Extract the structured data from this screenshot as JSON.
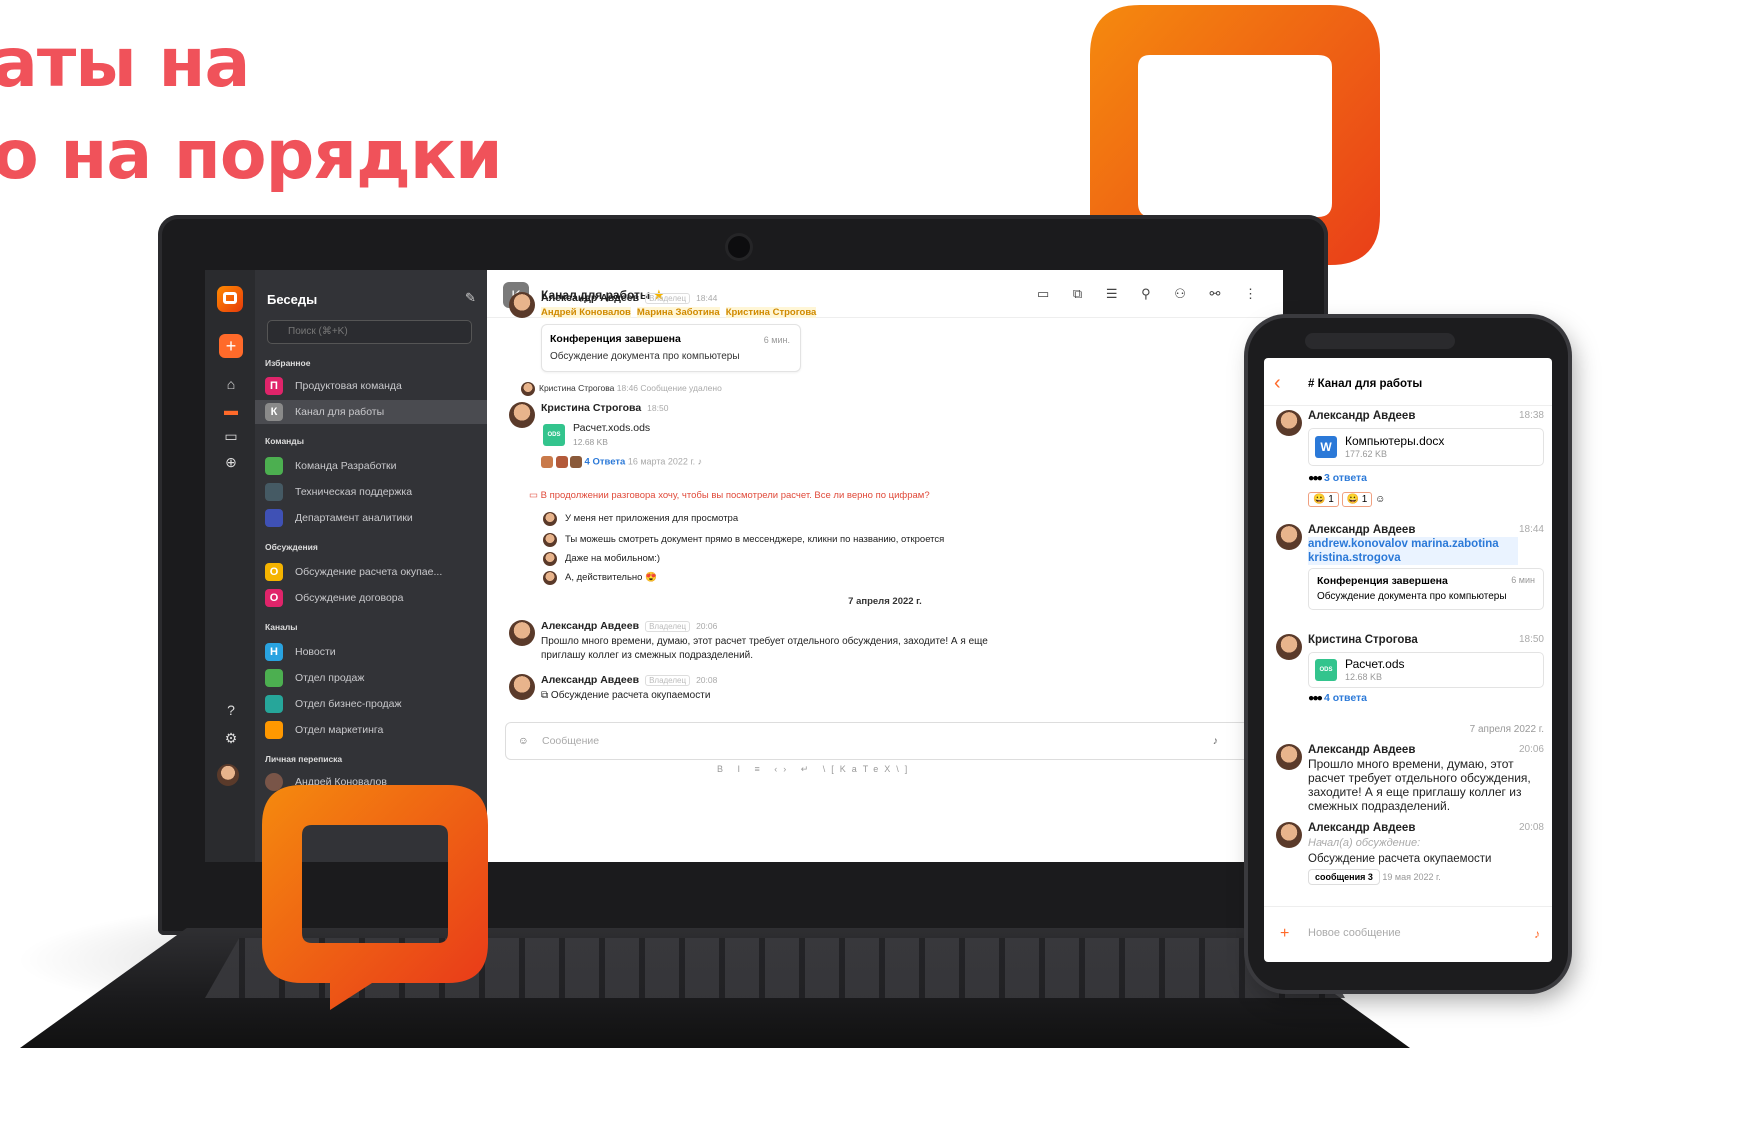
{
  "headline": {
    "line1": "аты на",
    "line2": "о на порядки"
  },
  "laptop": {
    "sidebar": {
      "title": "Беседы",
      "search_placeholder": "Поиск (⌘+K)",
      "sections": {
        "favorites": "Избранное",
        "teams": "Команды",
        "discussions": "Обсуждения",
        "channels": "Каналы",
        "personal": "Личная переписка"
      },
      "items": [
        {
          "label": "Продуктовая команда",
          "avatar": "П",
          "color": "#e0246a"
        },
        {
          "label": "Канал для работы",
          "avatar": "К",
          "color": "#8a8a8a"
        },
        {
          "label": "Команда Разработки",
          "avatar": "",
          "color": "#4caf50"
        },
        {
          "label": "Техническая поддержка",
          "avatar": "",
          "color": "#455a64"
        },
        {
          "label": "Департамент аналитики",
          "avatar": "",
          "color": "#3f51b5"
        },
        {
          "label": "Обсуждение расчета окупае...",
          "avatar": "О",
          "color": "#f5b400"
        },
        {
          "label": "Обсуждение договора",
          "avatar": "О",
          "color": "#e0246a"
        },
        {
          "label": "Новости",
          "avatar": "Н",
          "color": "#29a3e0"
        },
        {
          "label": "Отдел продаж",
          "avatar": "",
          "color": "#4caf50"
        },
        {
          "label": "Отдел бизнес-продаж",
          "avatar": "",
          "color": "#26a69a"
        },
        {
          "label": "Отдел маркетинга",
          "avatar": "",
          "color": "#ff9800"
        },
        {
          "label": "Андрей Коновалов",
          "avatar": "",
          "color": "#795548"
        }
      ]
    },
    "chat": {
      "header": {
        "avatar": "K",
        "title": "Канал для работы",
        "star": "★",
        "icons": "▭ ⧉ ☰ ⚲ ⚇ ⚯ ⋮"
      },
      "m1": {
        "name": "Александр Авдеев",
        "role": "Владелец",
        "time": "18:44",
        "mentions": [
          "Андрей Коновалов",
          "Марина Заботина",
          "Кристина Строгова"
        ],
        "card_title": "Конференция завершена",
        "card_time": "6 мин.",
        "card_text": "Обсуждение документа про компьютеры"
      },
      "deleted": {
        "name": "Кристина Строгова",
        "time": "18:46",
        "text": "Сообщение удалено"
      },
      "m2": {
        "name": "Кристина Строгова",
        "time": "18:50",
        "file": "Расчет.xods.ods",
        "size": "12.68 KB",
        "file_badge": "ODS",
        "replies": "4 Ответа",
        "date": "16 марта 2022 г."
      },
      "thread": {
        "question": "В продолжении разговора хочу, чтобы вы посмотрели расчет. Все ли верно по цифрам?",
        "lines": [
          "У меня нет приложения для просмотра",
          "Ты можешь смотреть документ прямо в мессенджере, кликни по названию, откроется",
          "Даже на мобильном:)",
          "А, действительно 😍"
        ]
      },
      "date_sep": "7 апреля 2022 г.",
      "m3": {
        "name": "Александр Авдеев",
        "role": "Владелец",
        "time": "20:06",
        "text1": "Прошло много времени, думаю, этот расчет требует отдельного обсуждения, заходите! А я еще",
        "text2": "приглашу коллег из смежных подразделений."
      },
      "m4": {
        "name": "Александр Авдеев",
        "role": "Владелец",
        "time": "20:08",
        "text": "Обсуждение расчета окупаемости"
      },
      "composer_placeholder": "Сообщение",
      "format_bar": "B I ≡ ‹› ↵ \\[KaTeX\\]"
    }
  },
  "phone": {
    "header": {
      "back": "‹",
      "title": "Канал для работы"
    },
    "m1": {
      "name": "Александр Авдеев",
      "time": "18:38",
      "file": "Компьютеры.docx",
      "size": "177.62 KB",
      "replies": "3 ответа",
      "react1": "😀 1",
      "react2": "😀 1"
    },
    "m2": {
      "name": "Александр Авдеев",
      "time": "18:44",
      "mentions": "andrew.konovalov marina.zabotina kristina.strogova",
      "card_title": "Конференция завершена",
      "card_time": "6 мин",
      "card_text": "Обсуждение документа про компьютеры"
    },
    "m3": {
      "name": "Кристина Строгова",
      "time": "18:50",
      "file": "Расчет.ods",
      "size": "12.68 KB",
      "replies": "4 ответа"
    },
    "date_sep": "7 апреля 2022 г.",
    "m4": {
      "name": "Александр Авдеев",
      "time": "20:06",
      "text": "Прошло много времени, думаю, этот расчет требует отдельного обсуждения, заходите! А я еще приглашу коллег из смежных подразделений."
    },
    "m5": {
      "name": "Александр Авдеев",
      "time": "20:08",
      "sub": "Начал(а) обсуждение:",
      "text": "Обсуждение расчета окупаемости",
      "thread": "сообщения 3",
      "date": "19 мая 2022 г."
    },
    "composer_placeholder": "Новое сообщение"
  },
  "colors": {
    "brand_orange": "#f47a10",
    "brand_red": "#e8361a",
    "headline": "#f0525a"
  }
}
